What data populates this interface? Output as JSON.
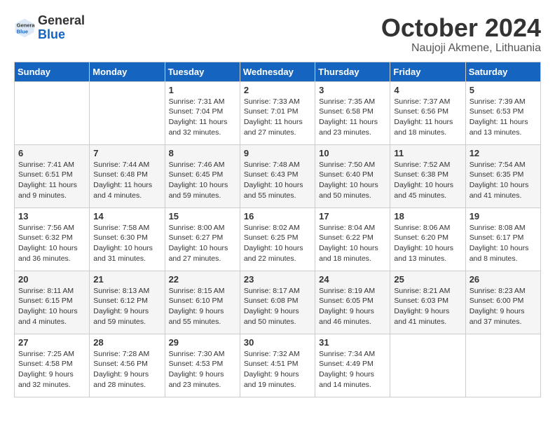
{
  "header": {
    "logo_general": "General",
    "logo_blue": "Blue",
    "month": "October 2024",
    "location": "Naujoji Akmene, Lithuania"
  },
  "days_of_week": [
    "Sunday",
    "Monday",
    "Tuesday",
    "Wednesday",
    "Thursday",
    "Friday",
    "Saturday"
  ],
  "weeks": [
    [
      {
        "day": "",
        "content": ""
      },
      {
        "day": "",
        "content": ""
      },
      {
        "day": "1",
        "content": "Sunrise: 7:31 AM\nSunset: 7:04 PM\nDaylight: 11 hours\nand 32 minutes."
      },
      {
        "day": "2",
        "content": "Sunrise: 7:33 AM\nSunset: 7:01 PM\nDaylight: 11 hours\nand 27 minutes."
      },
      {
        "day": "3",
        "content": "Sunrise: 7:35 AM\nSunset: 6:58 PM\nDaylight: 11 hours\nand 23 minutes."
      },
      {
        "day": "4",
        "content": "Sunrise: 7:37 AM\nSunset: 6:56 PM\nDaylight: 11 hours\nand 18 minutes."
      },
      {
        "day": "5",
        "content": "Sunrise: 7:39 AM\nSunset: 6:53 PM\nDaylight: 11 hours\nand 13 minutes."
      }
    ],
    [
      {
        "day": "6",
        "content": "Sunrise: 7:41 AM\nSunset: 6:51 PM\nDaylight: 11 hours\nand 9 minutes."
      },
      {
        "day": "7",
        "content": "Sunrise: 7:44 AM\nSunset: 6:48 PM\nDaylight: 11 hours\nand 4 minutes."
      },
      {
        "day": "8",
        "content": "Sunrise: 7:46 AM\nSunset: 6:45 PM\nDaylight: 10 hours\nand 59 minutes."
      },
      {
        "day": "9",
        "content": "Sunrise: 7:48 AM\nSunset: 6:43 PM\nDaylight: 10 hours\nand 55 minutes."
      },
      {
        "day": "10",
        "content": "Sunrise: 7:50 AM\nSunset: 6:40 PM\nDaylight: 10 hours\nand 50 minutes."
      },
      {
        "day": "11",
        "content": "Sunrise: 7:52 AM\nSunset: 6:38 PM\nDaylight: 10 hours\nand 45 minutes."
      },
      {
        "day": "12",
        "content": "Sunrise: 7:54 AM\nSunset: 6:35 PM\nDaylight: 10 hours\nand 41 minutes."
      }
    ],
    [
      {
        "day": "13",
        "content": "Sunrise: 7:56 AM\nSunset: 6:32 PM\nDaylight: 10 hours\nand 36 minutes."
      },
      {
        "day": "14",
        "content": "Sunrise: 7:58 AM\nSunset: 6:30 PM\nDaylight: 10 hours\nand 31 minutes."
      },
      {
        "day": "15",
        "content": "Sunrise: 8:00 AM\nSunset: 6:27 PM\nDaylight: 10 hours\nand 27 minutes."
      },
      {
        "day": "16",
        "content": "Sunrise: 8:02 AM\nSunset: 6:25 PM\nDaylight: 10 hours\nand 22 minutes."
      },
      {
        "day": "17",
        "content": "Sunrise: 8:04 AM\nSunset: 6:22 PM\nDaylight: 10 hours\nand 18 minutes."
      },
      {
        "day": "18",
        "content": "Sunrise: 8:06 AM\nSunset: 6:20 PM\nDaylight: 10 hours\nand 13 minutes."
      },
      {
        "day": "19",
        "content": "Sunrise: 8:08 AM\nSunset: 6:17 PM\nDaylight: 10 hours\nand 8 minutes."
      }
    ],
    [
      {
        "day": "20",
        "content": "Sunrise: 8:11 AM\nSunset: 6:15 PM\nDaylight: 10 hours\nand 4 minutes."
      },
      {
        "day": "21",
        "content": "Sunrise: 8:13 AM\nSunset: 6:12 PM\nDaylight: 9 hours\nand 59 minutes."
      },
      {
        "day": "22",
        "content": "Sunrise: 8:15 AM\nSunset: 6:10 PM\nDaylight: 9 hours\nand 55 minutes."
      },
      {
        "day": "23",
        "content": "Sunrise: 8:17 AM\nSunset: 6:08 PM\nDaylight: 9 hours\nand 50 minutes."
      },
      {
        "day": "24",
        "content": "Sunrise: 8:19 AM\nSunset: 6:05 PM\nDaylight: 9 hours\nand 46 minutes."
      },
      {
        "day": "25",
        "content": "Sunrise: 8:21 AM\nSunset: 6:03 PM\nDaylight: 9 hours\nand 41 minutes."
      },
      {
        "day": "26",
        "content": "Sunrise: 8:23 AM\nSunset: 6:00 PM\nDaylight: 9 hours\nand 37 minutes."
      }
    ],
    [
      {
        "day": "27",
        "content": "Sunrise: 7:25 AM\nSunset: 4:58 PM\nDaylight: 9 hours\nand 32 minutes."
      },
      {
        "day": "28",
        "content": "Sunrise: 7:28 AM\nSunset: 4:56 PM\nDaylight: 9 hours\nand 28 minutes."
      },
      {
        "day": "29",
        "content": "Sunrise: 7:30 AM\nSunset: 4:53 PM\nDaylight: 9 hours\nand 23 minutes."
      },
      {
        "day": "30",
        "content": "Sunrise: 7:32 AM\nSunset: 4:51 PM\nDaylight: 9 hours\nand 19 minutes."
      },
      {
        "day": "31",
        "content": "Sunrise: 7:34 AM\nSunset: 4:49 PM\nDaylight: 9 hours\nand 14 minutes."
      },
      {
        "day": "",
        "content": ""
      },
      {
        "day": "",
        "content": ""
      }
    ]
  ]
}
